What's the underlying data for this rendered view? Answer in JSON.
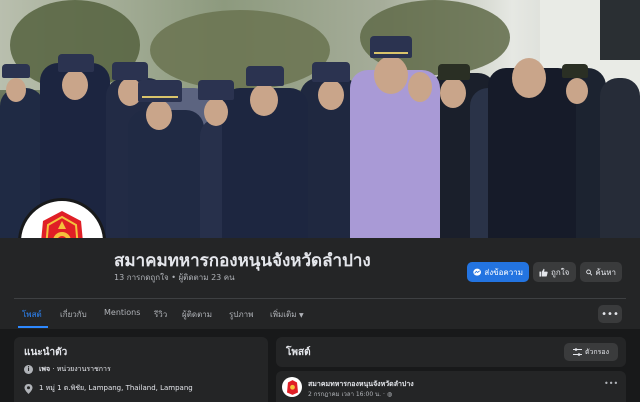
{
  "page": {
    "name": "สมาคมทหารกองหนุนจังหวัดลำปาง",
    "stats": "13 การกดถูกใจ • ผู้ติดตาม 23 คน"
  },
  "actions": {
    "message_label": "ส่งข้อความ",
    "like_label": "ถูกใจ",
    "search_label": "ค้นหา"
  },
  "tabs": [
    {
      "label": "โพสต์",
      "active": true
    },
    {
      "label": "เกี่ยวกับ"
    },
    {
      "label": "Mentions"
    },
    {
      "label": "รีวิว"
    },
    {
      "label": "ผู้ติดตาม"
    },
    {
      "label": "รูปภาพ"
    },
    {
      "label": "เพิ่มเติม"
    }
  ],
  "intro": {
    "title": "แนะนำตัว",
    "category_prefix": "เพจ",
    "category": "หน่วยงานราชการ",
    "address": "1 หมู่ 1 ต.พิชัย, Lampang, Thailand, Lampang"
  },
  "posts": {
    "title": "โพสต์",
    "filter_label": "ตัวกรอง",
    "first_post": {
      "author": "สมาคมทหารกองหนุนจังหวัดลำปาง",
      "meta": "2 กรกฎาคม เวลา 16:00 น. ·"
    }
  },
  "cover": {
    "cap_label": "เกษียณ"
  },
  "colors": {
    "accent": "#2d88ff",
    "primary_button": "#2374e1",
    "background": "#18191a",
    "surface": "#242526"
  },
  "icons": {
    "messenger": "messenger-icon",
    "like": "thumbs-up-icon",
    "search": "search-icon",
    "more": "more-horizontal-icon",
    "info": "info-icon",
    "location": "location-pin-icon",
    "filter": "filter-icon",
    "globe": "globe-icon"
  }
}
